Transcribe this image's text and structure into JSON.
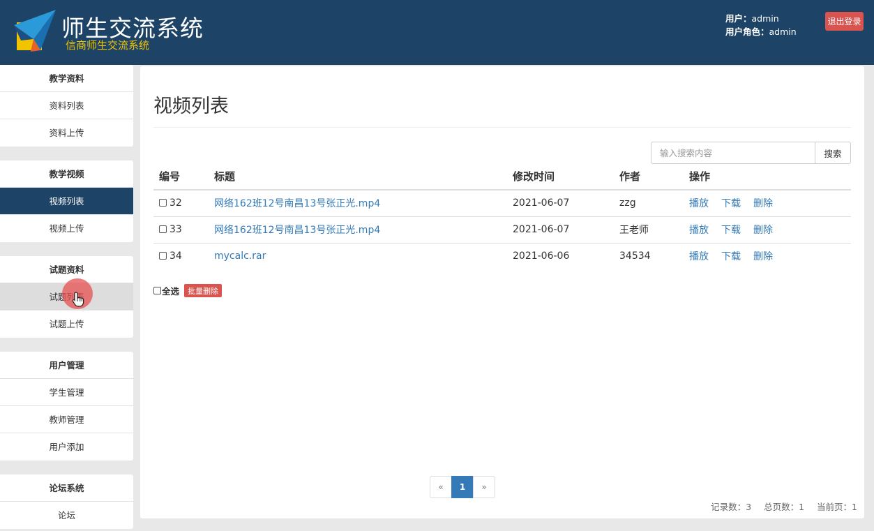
{
  "brand": {
    "title": "师生交流系统",
    "subtitle": "信商师生交流系统"
  },
  "user": {
    "user_label": "用户：",
    "user_value": "admin",
    "role_label": "用户角色：",
    "role_value": "admin",
    "logout_label": "退出登录"
  },
  "sidebar": {
    "groups": [
      {
        "head": "教学资料",
        "items": [
          "资料列表",
          "资料上传"
        ]
      },
      {
        "head": "教学视频",
        "items": [
          "视频列表",
          "视频上传"
        ]
      },
      {
        "head": "试题资料",
        "items": [
          "试题列表",
          "试题上传"
        ]
      },
      {
        "head": "用户管理",
        "items": [
          "学生管理",
          "教师管理",
          "用户添加"
        ]
      },
      {
        "head": "论坛系统",
        "items": [
          "论坛"
        ]
      }
    ],
    "active_item": "视频列表",
    "hovered_item": "试题列表"
  },
  "main": {
    "title": "视频列表",
    "search": {
      "placeholder": "输入搜索内容",
      "button": "搜索"
    },
    "table": {
      "headers": [
        "编号",
        "标题",
        "修改时间",
        "作者",
        "操作"
      ],
      "rows": [
        {
          "id": "32",
          "title": "网络162班12号南昌13号张正光.mp4",
          "date": "2021-06-07",
          "author": "zzg"
        },
        {
          "id": "33",
          "title": "网络162班12号南昌13号张正光.mp4",
          "date": "2021-06-07",
          "author": "王老师"
        },
        {
          "id": "34",
          "title": "mycalc.rar",
          "date": "2021-06-06",
          "author": "34534"
        }
      ],
      "actions": [
        "播放",
        "下载",
        "删除"
      ]
    },
    "select_all_label": "全选",
    "bulk_delete_label": "批量删除",
    "pagination": {
      "prev": "«",
      "current": "1",
      "next": "»"
    },
    "stats": {
      "records": "记录数：3",
      "pages": "总页数：1",
      "current": "当前页：1"
    }
  },
  "colors": {
    "header_bg": "#1d4366",
    "accent": "#337ab7",
    "danger": "#d9534f",
    "brand_sub": "#f2c400"
  }
}
